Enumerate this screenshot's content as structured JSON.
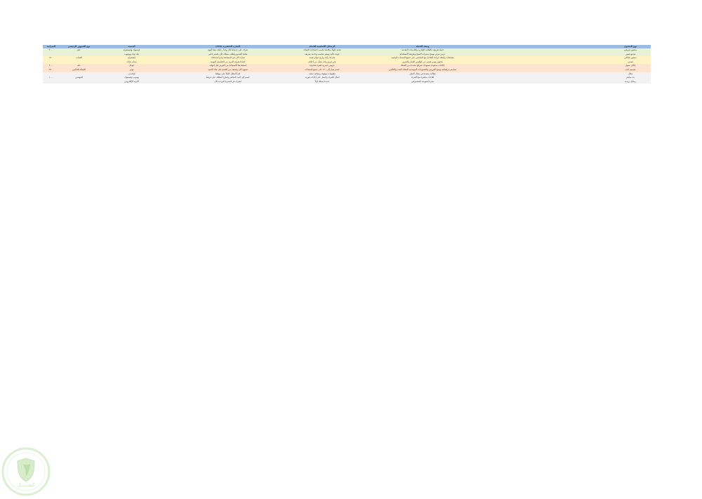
{
  "colors": {
    "header": "#9bbbe2",
    "bands": [
      "#e9f1d6",
      "#fff3c4",
      "#fde4d0",
      "#f2f2f2"
    ],
    "watermark": "#a9d49a"
  },
  "table": {
    "headers": [
      "نوع المحتوى",
      "وصف الحملة",
      "الرسائل الأساسية للحملة",
      "العبارة التحفيزية (CTA)",
      "المنصة",
      "نوع الجمهور الرئيسي",
      "الميزانية"
    ],
    "rows": [
      {
        "band": 0,
        "cells": [
          "منشور تعريفي",
          "حملة تعريفية بالعلامة التجارية والخدمات المقدمة",
          "نقدم حلولاً متكاملة تناسب احتياجات العملاء",
          "تعرف على خدماتنا الآن وابدأ رحلتك معنا اليوم",
          "فيسبوك وإنستغرام",
          "عام",
          "٢٠٠٠"
        ]
      },
      {
        "band": 0,
        "cells": [
          "فيديو قصير",
          "عرض مرئي يوضح مميزات المنتج وطريقة الاستخدام",
          "جودة عالية وسعر مناسب وخدمة سريعة",
          "شاهد الفيديو واطلب منتجك الآن بخصم خاص",
          "تيك توك ويوتيوب",
          "",
          ""
        ]
      },
      {
        "band": 1,
        "cells": [
          "منشور تفاعلي",
          "مسابقات وأسئلة لزيادة التفاعل مع المتابعين على جميع المنصات الرقمية",
          "شاركنا رأيك واربح جوائز قيمة",
          "شارك الآن في المسابقة وادع أصدقاءك",
          "إنستغرام",
          "الشباب",
          "١٥٠٠"
        ]
      },
      {
        "band": 1,
        "cells": [
          "قصص",
          "محتوى يومي قصير عن كواليس العمل والفريق",
          "نحن فريق واحد يعمل من أجلكم",
          "تابعنا لمعرفة المزيد من التفاصيل اليومية",
          "سناب شات",
          "",
          ""
        ]
      },
      {
        "band": 2,
        "cells": [
          "إعلان ممول",
          "إعلانات مدفوعة تستهدف شرائح محددة من العملاء",
          "عروض حصرية لفترة محدودة",
          "اضغط هنا للاستفادة من العرض قبل انتهائه",
          "جوجل",
          "عام",
          "٣٠٠٠"
        ]
      },
      {
        "band": 2,
        "cells": [
          "تصميم ثابت",
          "تصاميم جرافيكية توضح العروض والخصومات الموسمية للعملاء الجدد والحاليين",
          "خصم يصل إلى ٣٠٪ على جميع المنتجات",
          "تسوق الآن واستفد من الخصم قبل نفاد الكمية",
          "تويتر",
          "العملاء الحاليين",
          "٢٥٠٠"
        ]
      },
      {
        "band": 3,
        "cells": [
          "مقال",
          "مقالات مفيدة في مجال العمل",
          "معلومات موثوقة ونصائح عملية",
          "اقرأ المقال كاملاً على موقعنا",
          "لينكد إن",
          "",
          ""
        ]
      },
      {
        "band": 3,
        "cells": [
          "بث مباشر",
          "لقاءات مباشرة مع الخبراء",
          "اسأل الخبراء واحصل على إجابات فورية",
          "انضم إلى البث المباشر واطرح أسئلتك على فريقنا",
          "يوتيوب وفيسبوك",
          "المهتمين",
          "١٠٠٠"
        ]
      },
      {
        "band": 3,
        "cells": [
          "رسائل بريدية",
          "نشرة أسبوعية للمشتركين",
          "جديدنا يصلك أولاً",
          "اشترك في النشرة البريدية الآن",
          "البريد الإلكتروني",
          "",
          ""
        ]
      }
    ]
  },
  "watermark": {
    "icon": "shield-leaf-icon",
    "text": "كشـــــل"
  }
}
